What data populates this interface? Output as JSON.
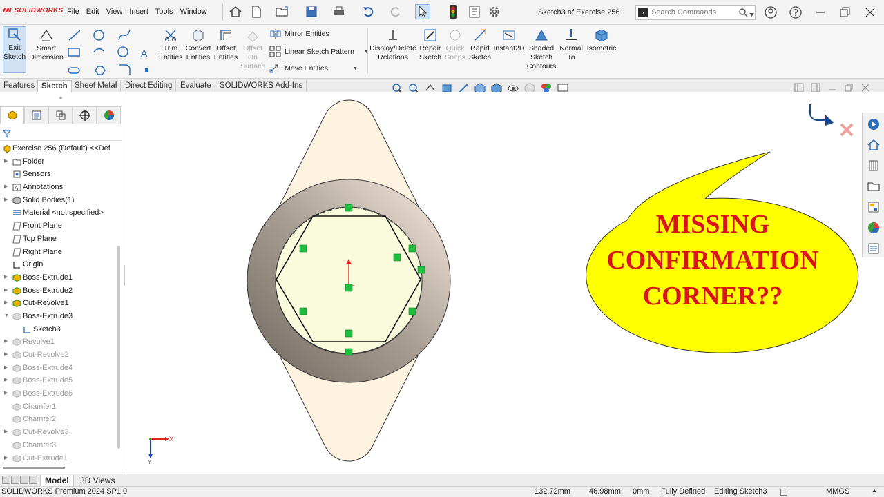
{
  "app": {
    "logo": "SOLIDWORKS",
    "window_title": "Sketch3 of Exercise 256",
    "menu": [
      "File",
      "Edit",
      "View",
      "Insert",
      "Tools",
      "Window"
    ],
    "search_placeholder": "Search Commands"
  },
  "ribbon": {
    "exit_sketch": [
      "Exit",
      "Sketch"
    ],
    "smart_dimension": [
      "Smart",
      "Dimension"
    ],
    "trim": [
      "Trim",
      "Entities"
    ],
    "convert": [
      "Convert",
      "Entities"
    ],
    "offset": [
      "Offset",
      "Entities"
    ],
    "offset_surface": [
      "Offset",
      "On",
      "Surface"
    ],
    "mirror": "Mirror Entities",
    "linear_pattern": "Linear Sketch Pattern",
    "move": "Move Entities",
    "display_delete": [
      "Display/Delete",
      "Relations"
    ],
    "repair": [
      "Repair",
      "Sketch"
    ],
    "quick_snaps": [
      "Quick",
      "Snaps"
    ],
    "rapid": [
      "Rapid",
      "Sketch"
    ],
    "instant2d": "Instant2D",
    "shaded": [
      "Shaded",
      "Sketch",
      "Contours"
    ],
    "normal_to": [
      "Normal",
      "To"
    ],
    "isometric": "Isometric"
  },
  "tabs": [
    "Features",
    "Sketch",
    "Sheet Metal",
    "Direct Editing",
    "Evaluate",
    "SOLIDWORKS Add-Ins"
  ],
  "tree": {
    "root": "Exercise 256 (Default) <<Def",
    "items": [
      {
        "label": "Folder",
        "expand": true,
        "state": "normal"
      },
      {
        "label": "Sensors",
        "expand": false,
        "state": "normal"
      },
      {
        "label": "Annotations",
        "expand": true,
        "state": "normal"
      },
      {
        "label": "Solid Bodies(1)",
        "expand": true,
        "state": "normal"
      },
      {
        "label": "Material <not specified>",
        "expand": false,
        "state": "normal"
      },
      {
        "label": "Front Plane",
        "expand": false,
        "state": "normal"
      },
      {
        "label": "Top Plane",
        "expand": false,
        "state": "normal"
      },
      {
        "label": "Right Plane",
        "expand": false,
        "state": "normal"
      },
      {
        "label": "Origin",
        "expand": false,
        "state": "normal"
      },
      {
        "label": "Boss-Extrude1",
        "expand": true,
        "state": "normal"
      },
      {
        "label": "Boss-Extrude2",
        "expand": true,
        "state": "normal"
      },
      {
        "label": "Cut-Revolve1",
        "expand": true,
        "state": "normal"
      },
      {
        "label": "Boss-Extrude3",
        "expand": true,
        "state": "open"
      },
      {
        "label": "Sketch3",
        "expand": false,
        "state": "child"
      },
      {
        "label": "Revolve1",
        "expand": true,
        "state": "suppressed"
      },
      {
        "label": "Cut-Revolve2",
        "expand": true,
        "state": "suppressed"
      },
      {
        "label": "Boss-Extrude4",
        "expand": true,
        "state": "suppressed"
      },
      {
        "label": "Boss-Extrude5",
        "expand": true,
        "state": "suppressed"
      },
      {
        "label": "Boss-Extrude6",
        "expand": true,
        "state": "suppressed"
      },
      {
        "label": "Chamfer1",
        "expand": false,
        "state": "suppressed"
      },
      {
        "label": "Chamfer2",
        "expand": false,
        "state": "suppressed"
      },
      {
        "label": "Cut-Revolve3",
        "expand": true,
        "state": "suppressed"
      },
      {
        "label": "Chamfer3",
        "expand": false,
        "state": "suppressed"
      },
      {
        "label": "Cut-Extrude1",
        "expand": true,
        "state": "suppressed"
      }
    ]
  },
  "callout": {
    "lines": [
      "MISSING",
      "CONFIRMATION",
      "CORNER??"
    ],
    "fill": "#ffff00",
    "text_color": "#d9141b"
  },
  "triad": {
    "x": "X",
    "y": "Y"
  },
  "bottom_tabs": [
    "Model",
    "3D Views"
  ],
  "status": {
    "product": "SOLIDWORKS Premium 2024 SP1.0",
    "x": "132.72mm",
    "y": "46.98mm",
    "z": "0mm",
    "defined": "Fully Defined",
    "editing": "Editing Sketch3",
    "units": "MMGS"
  },
  "colors": {
    "relation_green": "#1fbf3f",
    "part_face": "#fdf3e0",
    "hole_fill": "#fafadd"
  }
}
